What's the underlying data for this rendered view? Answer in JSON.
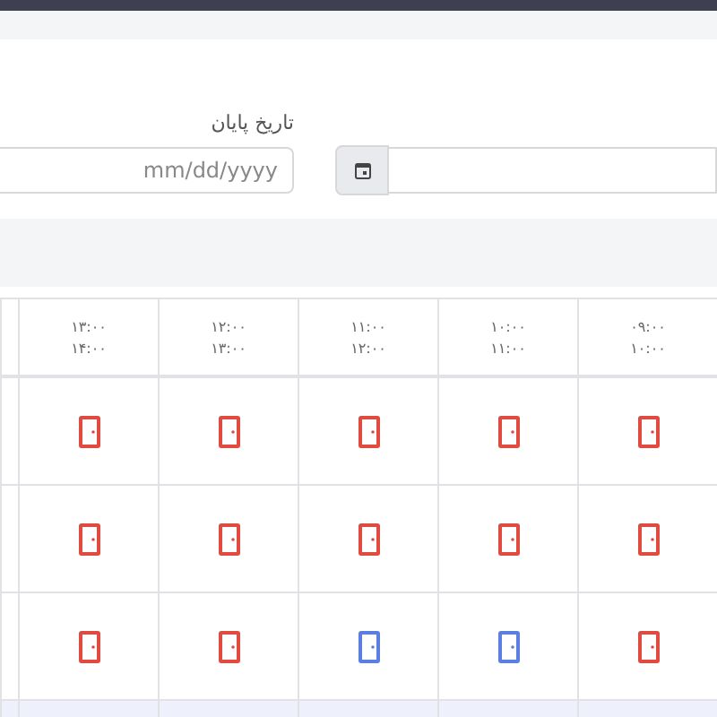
{
  "filter": {
    "end_date": {
      "label": "تاریخ پایان",
      "placeholder": "mm/dd/yyyy"
    }
  },
  "table": {
    "columns": [
      {
        "start": "۰۹:۰۰",
        "end": "۱۰:۰۰"
      },
      {
        "start": "۱۰:۰۰",
        "end": "۱۱:۰۰"
      },
      {
        "start": "۱۱:۰۰",
        "end": "۱۲:۰۰"
      },
      {
        "start": "۱۲:۰۰",
        "end": "۱۳:۰۰"
      },
      {
        "start": "۱۳:۰۰",
        "end": "۱۴:۰۰"
      }
    ],
    "rows": [
      {
        "cells": [
          {
            "available": false
          },
          {
            "available": false
          },
          {
            "available": false
          },
          {
            "available": false
          },
          {
            "available": false
          }
        ]
      },
      {
        "cells": [
          {
            "available": false
          },
          {
            "available": false
          },
          {
            "available": false
          },
          {
            "available": false
          },
          {
            "available": false
          }
        ]
      },
      {
        "cells": [
          {
            "available": false
          },
          {
            "available": true
          },
          {
            "available": true
          },
          {
            "available": false
          },
          {
            "available": false
          }
        ]
      }
    ]
  }
}
